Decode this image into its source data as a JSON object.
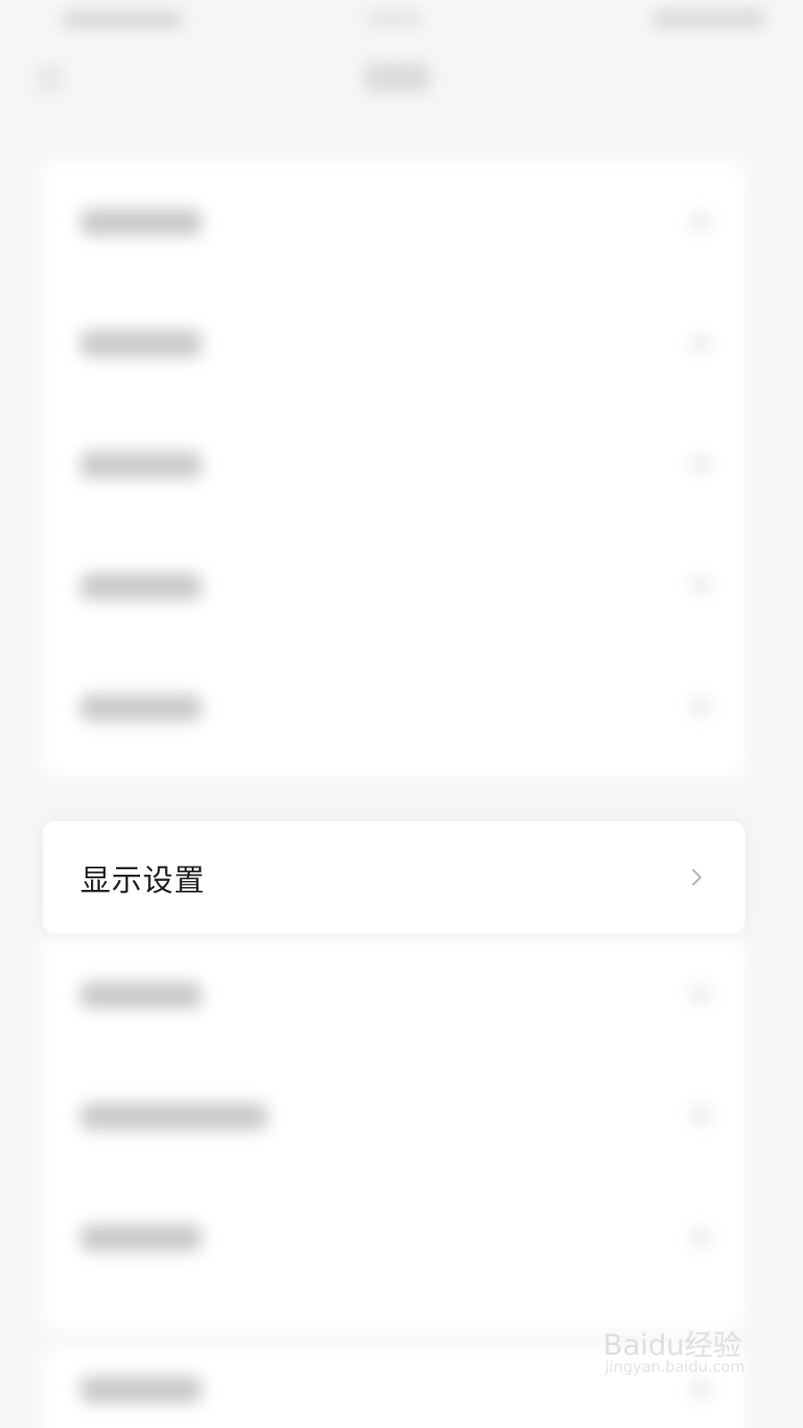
{
  "main": {
    "focused_item": {
      "label": "显示设置",
      "chevron": "chevron-right-icon"
    }
  },
  "watermark": {
    "main": "Baidu经验",
    "sub": "jingyan.baidu.com"
  },
  "colors": {
    "background": "#f7f7f7",
    "card": "#ffffff",
    "text": "#1d1d1d",
    "chevron": "#b9b9b9",
    "watermark": "#b9b9b9"
  }
}
